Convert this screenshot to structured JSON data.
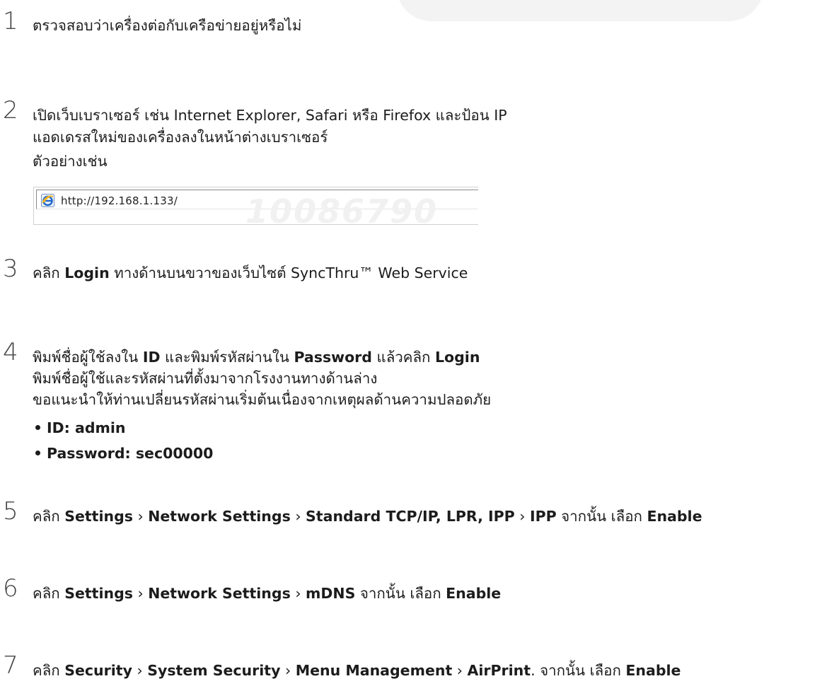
{
  "steps": [
    {
      "number": "1",
      "lines": [
        "ตรวจสอบว่าเครื่องต่อกับเครือข่ายอยู่หรือไม่"
      ]
    },
    {
      "number": "2",
      "lines": [
        "เปิดเว็บเบราเซอร์ เช่น Internet Explorer, Safari หรือ Firefox และป้อน IP",
        "แอดเดรสใหม่ของเครื่องลงในหน้าต่างเบราเซอร์",
        "ตัวอย่างเช่น"
      ],
      "example": {
        "icon": "internet-explorer-icon",
        "url": "http://192.168.1.133/",
        "watermark": "10086790"
      }
    },
    {
      "number": "3",
      "parts": [
        "คลิก ",
        "Login",
        " ทางด้านบนขวาของเว็บไซต์ SyncThru™ Web Service"
      ]
    },
    {
      "number": "4",
      "first_parts": [
        "พิมพ์ชื่อผู้ใช้ลงใน ",
        "ID",
        " และพิมพ์รหัสผ่านใน ",
        "Password",
        " แล้วคลิก ",
        "Login"
      ],
      "lines": [
        "พิมพ์ชื่อผู้ใช้และรหัสผ่านที่ตั้งมาจากโรงงานทางด้านล่าง",
        "ขอแนะนำให้ท่านเปลี่ยนรหัสผ่านเริ่มต้นเนื่องจากเหตุผลด้านความปลอดภัย"
      ],
      "bullets": [
        "ID: admin",
        "Password: sec00000"
      ]
    },
    {
      "number": "5",
      "prefix": "คลิก ",
      "path": [
        "Settings",
        "Network Settings",
        "Standard TCP/IP, LPR, IPP",
        "IPP"
      ],
      "suffix": " จากนั้น เลือก ",
      "action": "Enable"
    },
    {
      "number": "6",
      "prefix": "คลิก ",
      "path": [
        "Settings",
        "Network Settings",
        "mDNS"
      ],
      "suffix": " จากนั้น เลือก ",
      "action": "Enable"
    },
    {
      "number": "7",
      "prefix": "คลิก ",
      "path": [
        "Security",
        "System Security",
        "Menu Management",
        "AirPrint"
      ],
      "suffix": ". จากนั้น เลือก ",
      "action": "Enable"
    }
  ],
  "path_separator": "›"
}
